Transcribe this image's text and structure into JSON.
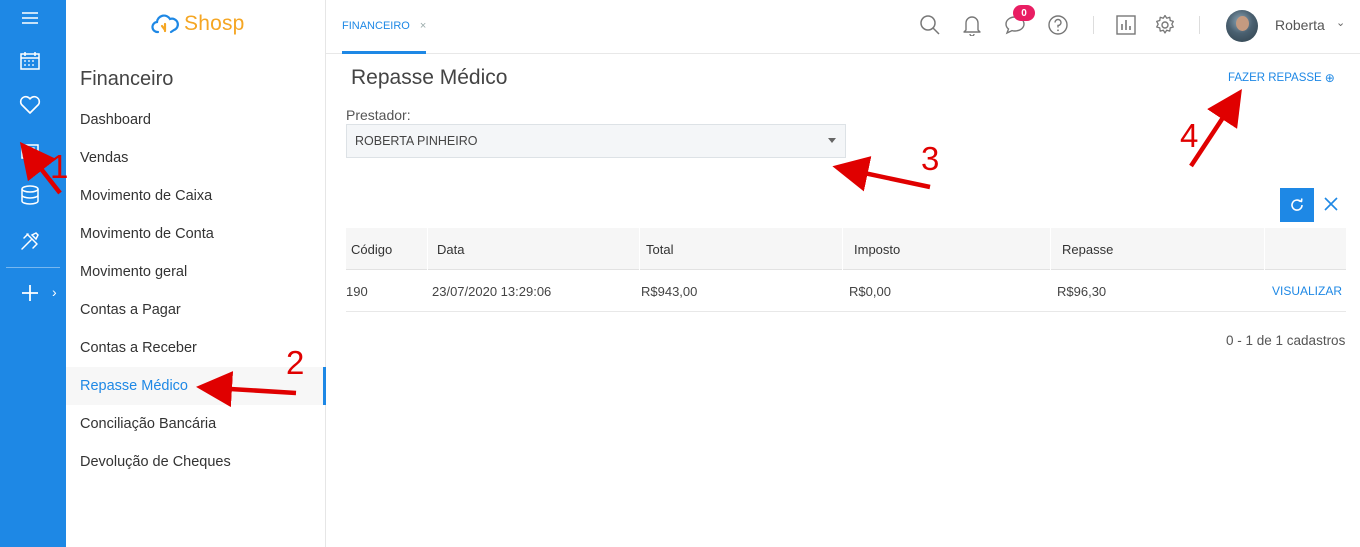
{
  "app": {
    "brand": "Shosp"
  },
  "rail": {
    "items": [
      {
        "icon": "menu-icon"
      },
      {
        "icon": "calendar-icon"
      },
      {
        "icon": "heart-icon"
      },
      {
        "icon": "finance-icon"
      },
      {
        "icon": "database-icon"
      },
      {
        "icon": "tools-icon"
      },
      {
        "icon": "plus-icon"
      }
    ],
    "expand_glyph": "›"
  },
  "sidebar": {
    "title": "Financeiro",
    "items": [
      {
        "label": "Dashboard",
        "active": false
      },
      {
        "label": "Vendas",
        "active": false
      },
      {
        "label": "Movimento de Caixa",
        "active": false
      },
      {
        "label": "Movimento de Conta",
        "active": false
      },
      {
        "label": "Movimento geral",
        "active": false
      },
      {
        "label": "Contas a Pagar",
        "active": false
      },
      {
        "label": "Contas a Receber",
        "active": false
      },
      {
        "label": "Repasse Médico",
        "active": true
      },
      {
        "label": "Conciliação Bancária",
        "active": false
      },
      {
        "label": "Devolução de Cheques",
        "active": false
      }
    ]
  },
  "topbar": {
    "tab_label": "FINANCEIRO",
    "tab_close": "×",
    "notifications_badge": "0",
    "user_name": "Roberta",
    "user_chevron": "⌄",
    "icons": [
      "search-icon",
      "bell-icon",
      "chat-icon",
      "help-icon",
      "report-icon",
      "gear-icon"
    ]
  },
  "page": {
    "title": "Repasse Médico",
    "action_label": "FAZER REPASSE",
    "action_icon": "⊕",
    "field_label": "Prestador:",
    "field_value": "ROBERTA PINHEIRO"
  },
  "table": {
    "columns": [
      "Código",
      "Data",
      "Total",
      "Imposto",
      "Repasse"
    ],
    "rows": [
      {
        "codigo": "190",
        "data": "23/07/2020 13:29:06",
        "total": "R$943,00",
        "imposto": "R$0,00",
        "repasse": "R$96,30",
        "action": "VISUALIZAR"
      }
    ],
    "footer": "0 - 1 de 1 cadastros"
  },
  "annotations": {
    "labels": [
      "1",
      "2",
      "3",
      "4"
    ],
    "color": "#e00000"
  },
  "colors": {
    "accent": "#1e88e5",
    "brand_orange": "#f5a623",
    "badge": "#e91e63",
    "annotation_red": "#e00000"
  }
}
